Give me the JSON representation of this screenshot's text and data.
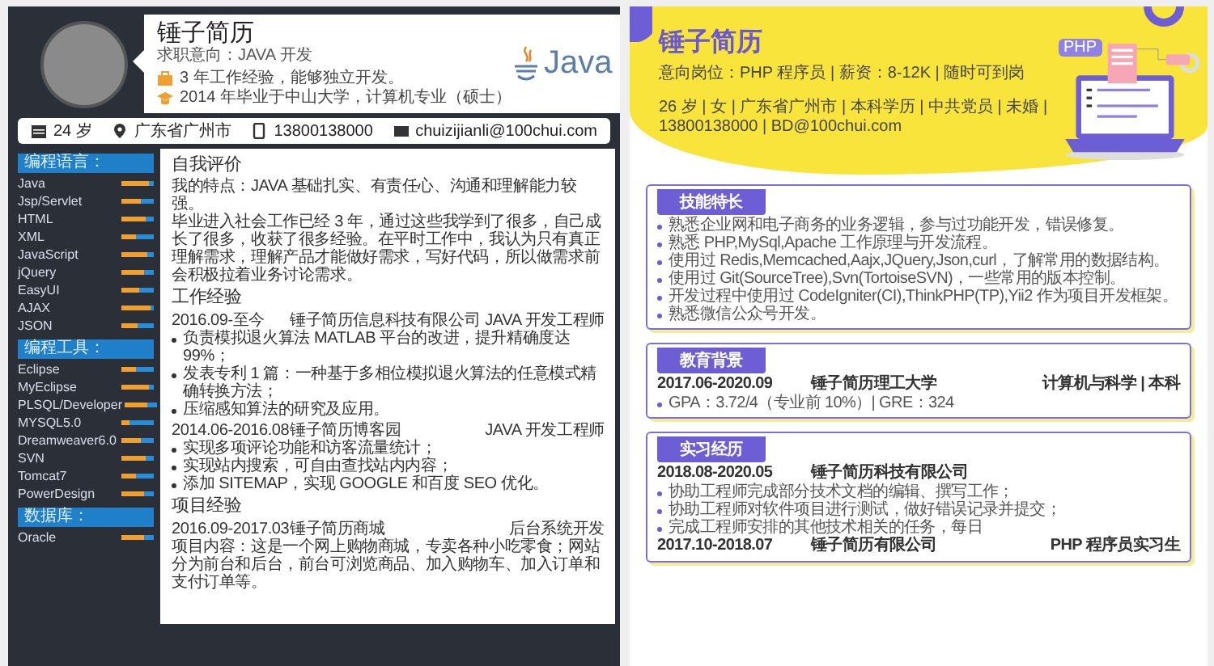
{
  "java_resume": {
    "name": "锤子简历",
    "intent": "求职意向：JAVA 开发",
    "logo_text": "Java",
    "highlights": [
      {
        "kind": "work",
        "text": "3 年工作经验，能够独立开发。"
      },
      {
        "kind": "education",
        "text": "2014 年毕业于中山大学，计算机专业（硕士）"
      }
    ],
    "contacts": [
      {
        "kind": "age",
        "text": "24 岁"
      },
      {
        "kind": "location",
        "text": "广东省广州市"
      },
      {
        "kind": "phone",
        "text": "13800138000"
      },
      {
        "kind": "email",
        "text": "chuizijianli@100chui.com"
      }
    ],
    "skill_groups": [
      {
        "title": "编程语言：",
        "skills": [
          {
            "name": "Java",
            "level": 0.85
          },
          {
            "name": "Jsp/Servlet",
            "level": 0.6
          },
          {
            "name": "HTML",
            "level": 0.75
          },
          {
            "name": "XML",
            "level": 0.45
          },
          {
            "name": "JavaScript",
            "level": 0.8
          },
          {
            "name": "jQuery",
            "level": 0.7
          },
          {
            "name": "EasyUI",
            "level": 0.55
          },
          {
            "name": "AJAX",
            "level": 0.9
          },
          {
            "name": "JSON",
            "level": 0.5
          }
        ]
      },
      {
        "title": "编程工具：",
        "skills": [
          {
            "name": "Eclipse",
            "level": 0.45
          },
          {
            "name": "MyEclipse",
            "level": 0.85
          },
          {
            "name": "PLSQL/Developer",
            "level": 0.7
          },
          {
            "name": "MYSQL5.0",
            "level": 0.25
          },
          {
            "name": "Dreamweaver6.0",
            "level": 0.6
          },
          {
            "name": "SVN",
            "level": 0.75
          },
          {
            "name": "Tomcat7",
            "level": 0.45
          },
          {
            "name": "PowerDesign",
            "level": 0.7
          }
        ]
      },
      {
        "title": "数据库：",
        "skills": [
          {
            "name": "Oracle",
            "level": 0.7
          }
        ]
      }
    ],
    "sections": [
      {
        "title": "自我评价",
        "paragraphs": [
          "我的特点：JAVA 基础扎实、有责任心、沟通和理解能力较强。",
          "毕业进入社会工作已经 3 年，通过这些我学到了很多，自己成长了很多，收获了很多经验。在平时工作中，我认为只有真正理解需求，理解产品才能做好需求，写好代码，所以做需求前会积极拉着业务讨论需求。"
        ]
      },
      {
        "title": "工作经验",
        "entries": [
          {
            "date": "2016.09-至今",
            "org": "锤子简历信息科技有限公司",
            "role": "JAVA 开发工程师",
            "bullets": [
              "负责模拟退火算法 MATLAB 平台的改进，提升精确度达 99%；",
              "发表专利 1 篇：一种基于多相位模拟退火算法的任意模式精确转换方法；",
              "压缩感知算法的研究及应用。"
            ]
          },
          {
            "date": "2014.06-2016.08",
            "org": "锤子简历博客园",
            "role": "JAVA 开发工程师",
            "bullets": [
              "实现多项评论功能和访客流量统计；",
              "实现站内搜索，可自由查找站内内容；",
              "添加 SITEMAP，实现 GOOGLE 和百度 SEO 优化。"
            ]
          }
        ]
      },
      {
        "title": "项目经验",
        "entries": [
          {
            "date": "2016.09-2017.03",
            "org": "锤子简历商城",
            "role": "后台系统开发",
            "paragraphs": [
              "项目内容：这是一个网上购物商城，专卖各种小吃零食；网站分为前台和后台，前台可浏览商品、加入购物车、加入订单和支付订单等。"
            ]
          }
        ]
      }
    ]
  },
  "php_resume": {
    "name": "锤子简历",
    "intent": "意向岗位：PHP 程序员 | 薪资：8-12K | 随时可到岗",
    "details": "26 岁 | 女 | 广东省广州市 | 本科学历 | 中共党员 | 未婚 | 13800138000 | BD@100chui.com",
    "badge": "PHP",
    "sections": [
      {
        "title": "技能特长",
        "bullets": [
          "熟悉企业网和电子商务的业务逻辑，参与过功能开发，错误修复。",
          "熟悉 PHP,MySql,Apache 工作原理与开发流程。",
          "使用过 Redis,Memcached,Aajx,JQuery,Json,curl，了解常用的数据结构。",
          "使用过 Git(SourceTree),Svn(TortoiseSVN)，一些常用的版本控制。",
          "开发过程中使用过 CodeIgniter(CI),ThinkPHP(TP),Yii2 作为项目开发框架。",
          "熟悉微信公众号开发。"
        ]
      },
      {
        "title": "教育背景",
        "entries": [
          {
            "date": "2017.06-2020.09",
            "org": "锤子简历理工大学",
            "role": "计算机与科学 | 本科",
            "bullets": [
              "GPA：3.72/4（专业前 10%）| GRE：324"
            ]
          }
        ]
      },
      {
        "title": "实习经历",
        "entries": [
          {
            "date": "2018.08-2020.05",
            "org": "锤子简历科技有限公司",
            "bullets": [
              "协助工程师完成部分技术文档的编辑、撰写工作；",
              "协助工程师对软件项目进行测试，做好错误记录并提交；",
              "完成工程师安排的其他技术相关的任务，每日"
            ]
          },
          {
            "date": "2017.10-2018.07",
            "org": "锤子简历有限公司",
            "role": "PHP 程序员实习生"
          }
        ]
      }
    ]
  }
}
